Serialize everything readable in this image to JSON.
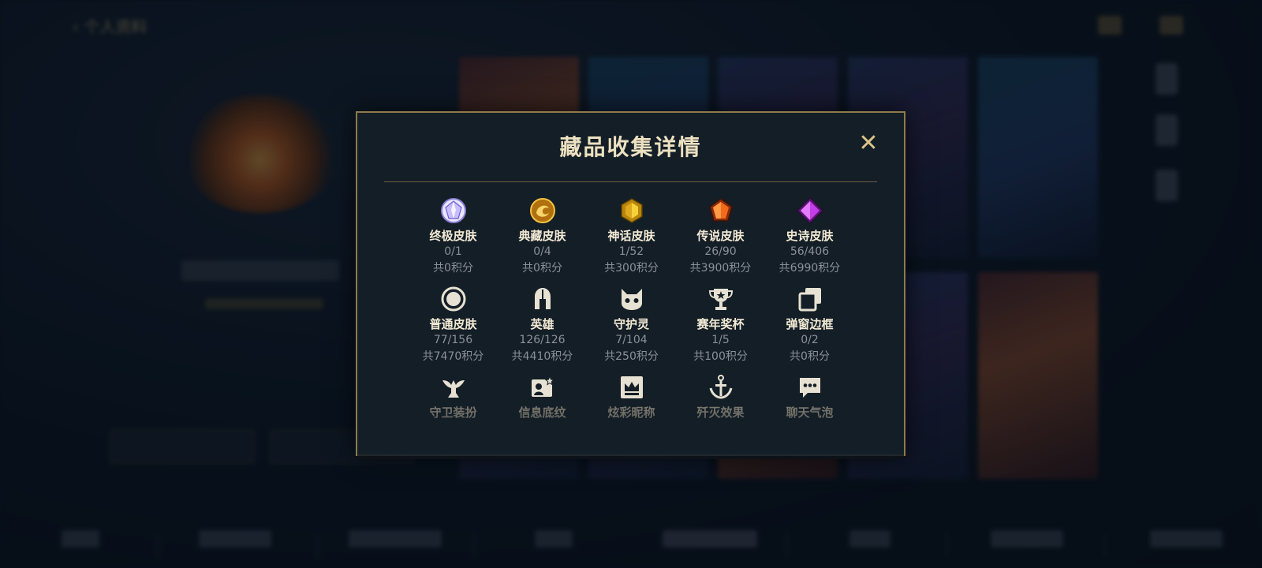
{
  "header": {
    "back_label": "个人资料"
  },
  "modal": {
    "title": "藏品收集详情",
    "close_glyph": "✕",
    "categories": [
      {
        "name": "终极皮肤",
        "count": "0/1",
        "points": "共0积分",
        "icon": "ultimate-gem-icon",
        "color": "#b9a6ff"
      },
      {
        "name": "典藏皮肤",
        "count": "0/4",
        "points": "共0积分",
        "icon": "dragon-medallion-icon",
        "color": "#e0a020"
      },
      {
        "name": "神话皮肤",
        "count": "1/52",
        "points": "共300积分",
        "icon": "mythic-gem-icon",
        "color": "#f1c40f"
      },
      {
        "name": "传说皮肤",
        "count": "26/90",
        "points": "共3900积分",
        "icon": "legendary-gem-icon",
        "color": "#e8641e"
      },
      {
        "name": "史诗皮肤",
        "count": "56/406",
        "points": "共6990积分",
        "icon": "epic-gem-icon",
        "color": "#b23cd6"
      },
      {
        "name": "普通皮肤",
        "count": "77/156",
        "points": "共7470积分",
        "icon": "ring-icon",
        "color": "#e6e1d2"
      },
      {
        "name": "英雄",
        "count": "126/126",
        "points": "共4410积分",
        "icon": "helmet-icon",
        "color": "#e6e1d2"
      },
      {
        "name": "守护灵",
        "count": "7/104",
        "points": "共250积分",
        "icon": "pet-icon",
        "color": "#e6e1d2"
      },
      {
        "name": "赛年奖杯",
        "count": "1/5",
        "points": "共100积分",
        "icon": "trophy-icon",
        "color": "#e6e1d2"
      },
      {
        "name": "弹窗边框",
        "count": "0/2",
        "points": "共0积分",
        "icon": "frames-icon",
        "color": "#e6e1d2"
      },
      {
        "name": "守卫装扮",
        "icon": "ward-icon",
        "color": "#e6e1d2"
      },
      {
        "name": "信息底纹",
        "icon": "banner-icon",
        "color": "#e6e1d2"
      },
      {
        "name": "炫彩昵称",
        "icon": "crown-card-icon",
        "color": "#e6e1d2"
      },
      {
        "name": "歼灭效果",
        "icon": "anchor-icon",
        "color": "#e6e1d2"
      },
      {
        "name": "聊天气泡",
        "icon": "chat-bubble-icon",
        "color": "#e6e1d2"
      }
    ]
  }
}
